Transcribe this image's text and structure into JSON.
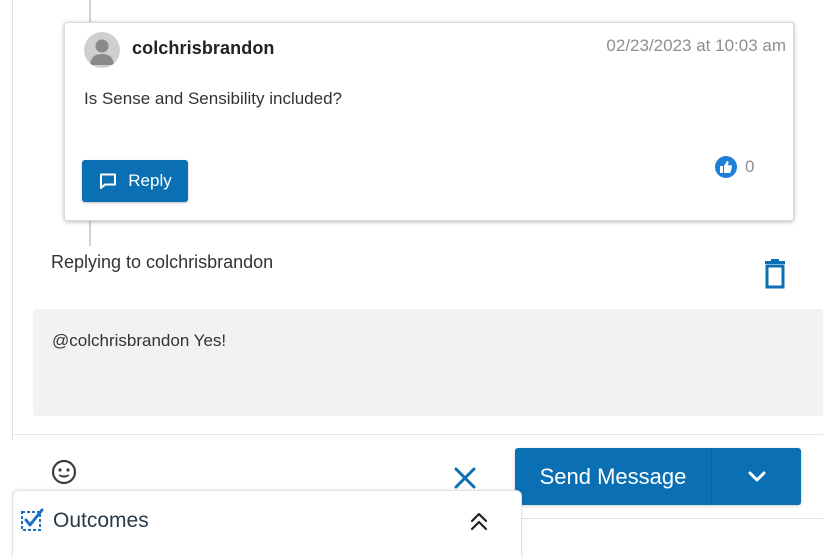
{
  "comment": {
    "username": "colchrisbrandon",
    "timestamp": "02/23/2023 at 10:03 am",
    "text": "Is Sense and Sensibility included?",
    "reply_label": "Reply",
    "like_count": "0",
    "avatar_icon": "user-silhouette-icon",
    "reply_icon": "speech-bubble-icon",
    "like_icon": "thumbs-up-icon"
  },
  "reply": {
    "replying_to_label": "Replying to colchrisbrandon",
    "delete_icon": "trash-icon",
    "draft_text": "@colchrisbrandon Yes!"
  },
  "composer_actions": {
    "emoji_icon": "emoji-icon",
    "cancel_icon": "close-icon",
    "send_label": "Send Message",
    "send_options_icon": "chevron-down-icon"
  },
  "outcomes": {
    "title": "Outcomes",
    "icon": "checklist-icon",
    "toggle_icon": "chevron-double-up-icon"
  },
  "colors": {
    "primary": "#0b6fb3",
    "like": "#1d7fd6",
    "muted_text": "#8a8f94",
    "compose_bg": "#f2f2f2"
  }
}
